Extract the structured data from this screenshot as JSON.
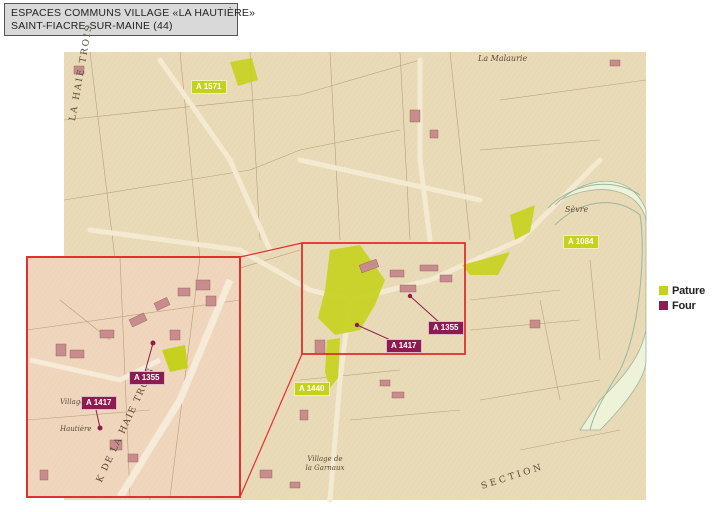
{
  "title": {
    "line1": "ESPACES COMMUNS VILLAGE «LA HAUTIÈRE»",
    "line2": "SAINT-FIACRE-SUR-MAINE (44)"
  },
  "legend": {
    "items": [
      {
        "label": "Pature",
        "color": "#c5d11d"
      },
      {
        "label": "Four",
        "color": "#8c1c4f"
      }
    ]
  },
  "parcels": {
    "a1571": "A 1571",
    "a1084": "A 1084",
    "a1355": "A 1355",
    "a1417": "A 1417",
    "a1440": "A 1440",
    "inset_a1355": "A 1355",
    "inset_a1417": "A 1417"
  },
  "map_labels": {
    "la_malaurie": "La Malaurie",
    "la_sevre": "Sèvre",
    "haie_trois": "LA HAIE TROIS",
    "de_la_haie_trois": "K DE LA HAIE TROIS",
    "section": "SECTION",
    "village_garnaux": "Village de la Garnaux",
    "hautiere": "Hautière",
    "village": "Village"
  },
  "colors": {
    "map_paper": "#eadbb8",
    "road": "#f4ead2",
    "river": "#eef2d8",
    "highlight_frame": "#e03030",
    "pature": "#c5d11d",
    "four": "#8c1c4f",
    "buildings": "#c98c8c"
  }
}
